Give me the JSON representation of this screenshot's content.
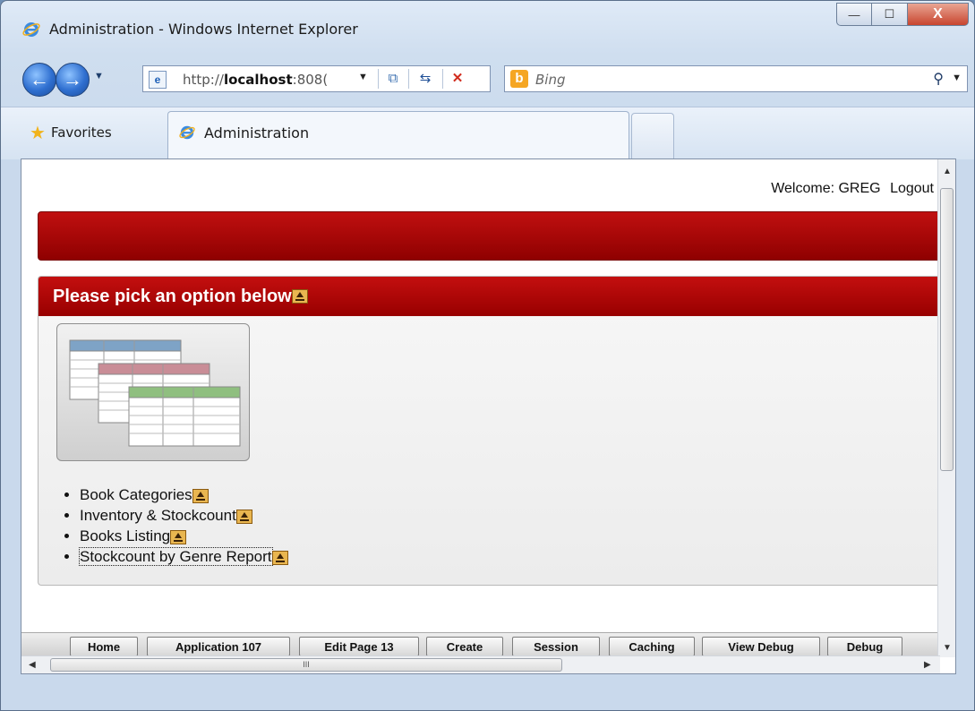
{
  "window": {
    "title": "Administration - Windows Internet Explorer",
    "controls": {
      "minimize": "—",
      "maximize": "☐",
      "close": "X"
    }
  },
  "nav": {
    "address_prefix": "http://",
    "address_host": "localhost",
    "address_rest": ":808(",
    "search_placeholder": "Bing"
  },
  "favorites": {
    "label": "Favorites"
  },
  "tabs": [
    {
      "label": "Administration"
    }
  ],
  "page": {
    "welcome_label": "Welcome: GREG",
    "logout_label": "Logout",
    "region_title": "Please pick an option below",
    "options": [
      {
        "label": "Book Categories"
      },
      {
        "label": "Inventory & Stockcount"
      },
      {
        "label": "Books Listing"
      },
      {
        "label": "Stockcount by Genre Report"
      }
    ]
  },
  "devbar": {
    "buttons": [
      {
        "label": "Home"
      },
      {
        "label": "Application 107"
      },
      {
        "label": "Edit Page 13"
      },
      {
        "label": "Create"
      },
      {
        "label": "Session"
      },
      {
        "label": "Caching"
      },
      {
        "label": "View Debug"
      },
      {
        "label": "Debug"
      }
    ]
  },
  "colors": {
    "header_red": "#b80808",
    "accent_blue": "#2f6fd0"
  }
}
